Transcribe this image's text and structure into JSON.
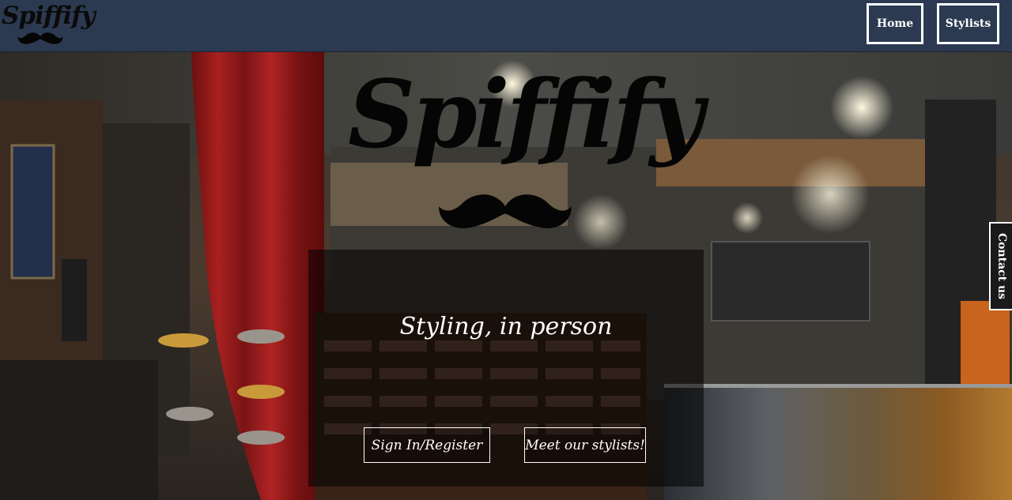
{
  "nav": {
    "brand": "Spiffify",
    "home_label": "Home",
    "stylists_label": "Stylists"
  },
  "hero": {
    "logo_text": "Spiffify",
    "tagline": "Styling, in person",
    "signin_label": "Sign In/Register",
    "meet_label": "Meet our stylists!"
  },
  "contact": {
    "label": "Contact us"
  },
  "colors": {
    "navbar": "#2b3a50",
    "button_border": "#ffffff",
    "logo": "#050505"
  },
  "icons": [
    "mustache-icon"
  ]
}
